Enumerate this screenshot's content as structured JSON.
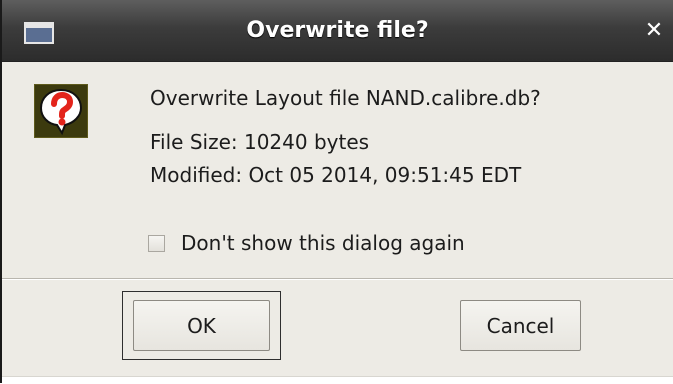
{
  "window": {
    "title": "Overwrite file?",
    "title_icon": "window-icon",
    "close_glyph": "✕"
  },
  "message": {
    "icon": "question-mark-icon",
    "main": "Overwrite Layout file NAND.calibre.db?",
    "file_size": "File Size: 10240 bytes",
    "modified": "Modified: Oct 05 2014, 09:51:45 EDT"
  },
  "checkbox": {
    "label": "Don't show this dialog again",
    "checked": false
  },
  "buttons": {
    "ok_label": "OK",
    "cancel_label": "Cancel"
  },
  "colors": {
    "titlebar": "#3c3c3c",
    "dialog_bg": "#edebe5",
    "icon_red": "#e3241b",
    "icon_olive": "#3c3a0e"
  }
}
